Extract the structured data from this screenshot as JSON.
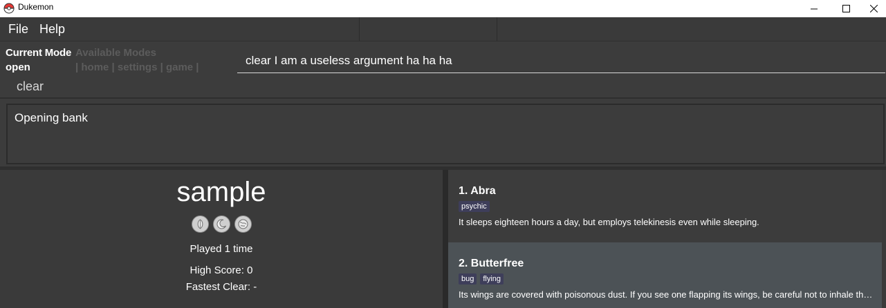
{
  "window": {
    "title": "Dukemon",
    "icon": "pokeball-icon"
  },
  "menu": {
    "items": [
      {
        "label": "File"
      },
      {
        "label": "Help"
      }
    ]
  },
  "mode": {
    "current_label": "Current Mode",
    "current_value": "open",
    "available_label": "Available Modes",
    "available_modes": "| home | settings | game |",
    "autocomplete_suggestion": "clear"
  },
  "command": {
    "value": "clear I am a useless argument ha ha ha"
  },
  "result": {
    "text": "Opening bank"
  },
  "bank": {
    "title": "sample",
    "badges": [
      "leaf-badge-icon",
      "moon-badge-icon",
      "globe-badge-icon"
    ],
    "played": "Played 1 time",
    "high_score": "High Score: 0",
    "fastest_clear": "Fastest Clear:  -"
  },
  "cards": [
    {
      "title": "1.  Abra",
      "tags": [
        "psychic"
      ],
      "description": "It sleeps eighteen hours a day, but employs telekinesis even while sleeping."
    },
    {
      "title": "2.  Butterfree",
      "tags": [
        "bug",
        "flying"
      ],
      "description": "Its wings are covered with poisonous dust. If you see one flapping its wings, be careful not to inhale the dust."
    }
  ],
  "colors": {
    "background": "#3c3c3c",
    "selected_card": "#4c5256",
    "tag": "#3e3e5a",
    "muted_text": "#5c5c5c"
  }
}
